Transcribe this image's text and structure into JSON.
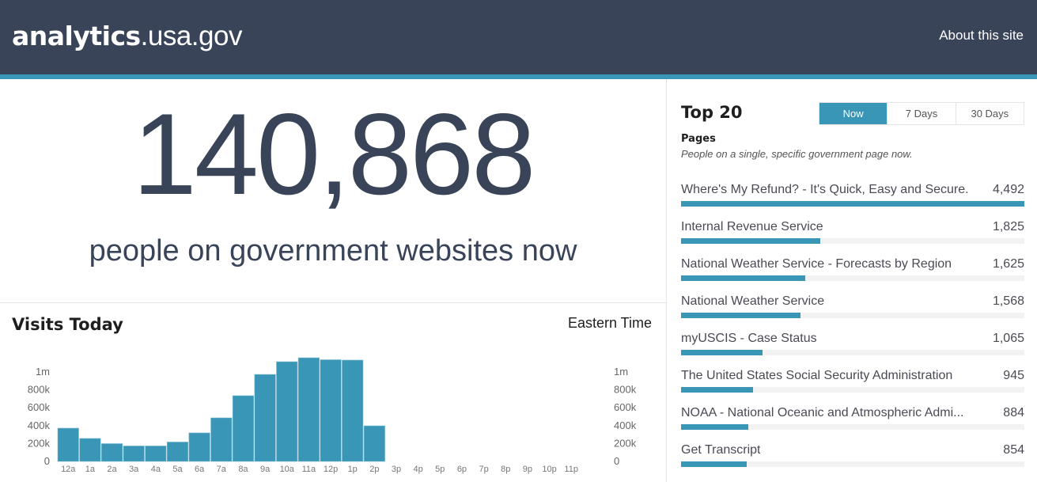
{
  "header": {
    "brand_bold": "analytics",
    "brand_light": ".usa.gov",
    "about_link": "About this site"
  },
  "colors": {
    "header_bg": "#394459",
    "accent": "#3a96b7"
  },
  "realtime": {
    "count": "140,868",
    "caption": "people on government websites now"
  },
  "visits": {
    "title": "Visits Today",
    "timezone": "Eastern Time"
  },
  "top": {
    "title": "Top 20",
    "tabs": [
      {
        "label": "Now",
        "active": true
      },
      {
        "label": "7 Days",
        "active": false
      },
      {
        "label": "30 Days",
        "active": false
      }
    ],
    "section_label": "Pages",
    "section_desc": "People on a single, specific government page now.",
    "items": [
      {
        "name": "Where's My Refund? - It's Quick, Easy and Secure.",
        "count": "4,492",
        "value": 4492
      },
      {
        "name": "Internal Revenue Service",
        "count": "1,825",
        "value": 1825
      },
      {
        "name": "National Weather Service - Forecasts by Region",
        "count": "1,625",
        "value": 1625
      },
      {
        "name": "National Weather Service",
        "count": "1,568",
        "value": 1568
      },
      {
        "name": "myUSCIS - Case Status",
        "count": "1,065",
        "value": 1065
      },
      {
        "name": "The United States Social Security Administration",
        "count": "945",
        "value": 945
      },
      {
        "name": "NOAA - National Oceanic and Atmospheric Admi...",
        "count": "884",
        "value": 884
      },
      {
        "name": "Get Transcript",
        "count": "854",
        "value": 854
      }
    ]
  },
  "chart_data": {
    "type": "bar",
    "title": "Visits Today",
    "xlabel": "",
    "ylabel": "",
    "categories": [
      "12a",
      "1a",
      "2a",
      "3a",
      "4a",
      "5a",
      "6a",
      "7a",
      "8a",
      "9a",
      "10a",
      "11a",
      "12p",
      "1p",
      "2p",
      "3p",
      "4p",
      "5p",
      "6p",
      "7p",
      "8p",
      "9p",
      "10p",
      "11p"
    ],
    "values": [
      372000,
      257000,
      199000,
      173000,
      173000,
      217000,
      319000,
      487000,
      735000,
      973000,
      1115000,
      1159000,
      1137000,
      1133000,
      398000,
      null,
      null,
      null,
      null,
      null,
      null,
      null,
      null,
      null
    ],
    "ylim": [
      0,
      1000000
    ],
    "yticks": [
      0,
      200000,
      400000,
      600000,
      800000,
      1000000
    ],
    "ytick_labels": [
      "0",
      "200k",
      "400k",
      "600k",
      "800k",
      "1m"
    ],
    "y_axis": "both-sides",
    "grid": false,
    "color": "#3a96b7"
  }
}
